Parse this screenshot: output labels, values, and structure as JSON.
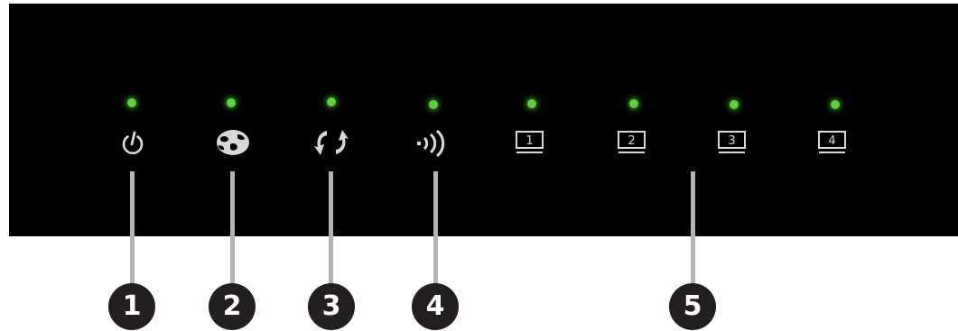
{
  "leds": [
    {
      "icon": "power-icon",
      "color": "#5fd03a"
    },
    {
      "icon": "internet-globe-icon",
      "color": "#5fd03a"
    },
    {
      "icon": "wps-arrows-icon",
      "color": "#5fd03a"
    },
    {
      "icon": "wireless-icon",
      "color": "#5fd03a"
    },
    {
      "icon": "lan-port-icon",
      "port": "1",
      "color": "#5fd03a"
    },
    {
      "icon": "lan-port-icon",
      "port": "2",
      "color": "#5fd03a"
    },
    {
      "icon": "lan-port-icon",
      "port": "3",
      "color": "#5fd03a"
    },
    {
      "icon": "lan-port-icon",
      "port": "4",
      "color": "#5fd03a"
    }
  ],
  "callouts": [
    "1",
    "2",
    "3",
    "4",
    "5"
  ],
  "colors": {
    "panel": "#000000",
    "icon": "#d8d8d8",
    "leader_line": "#b4b4b4",
    "callout": "#231f20"
  }
}
